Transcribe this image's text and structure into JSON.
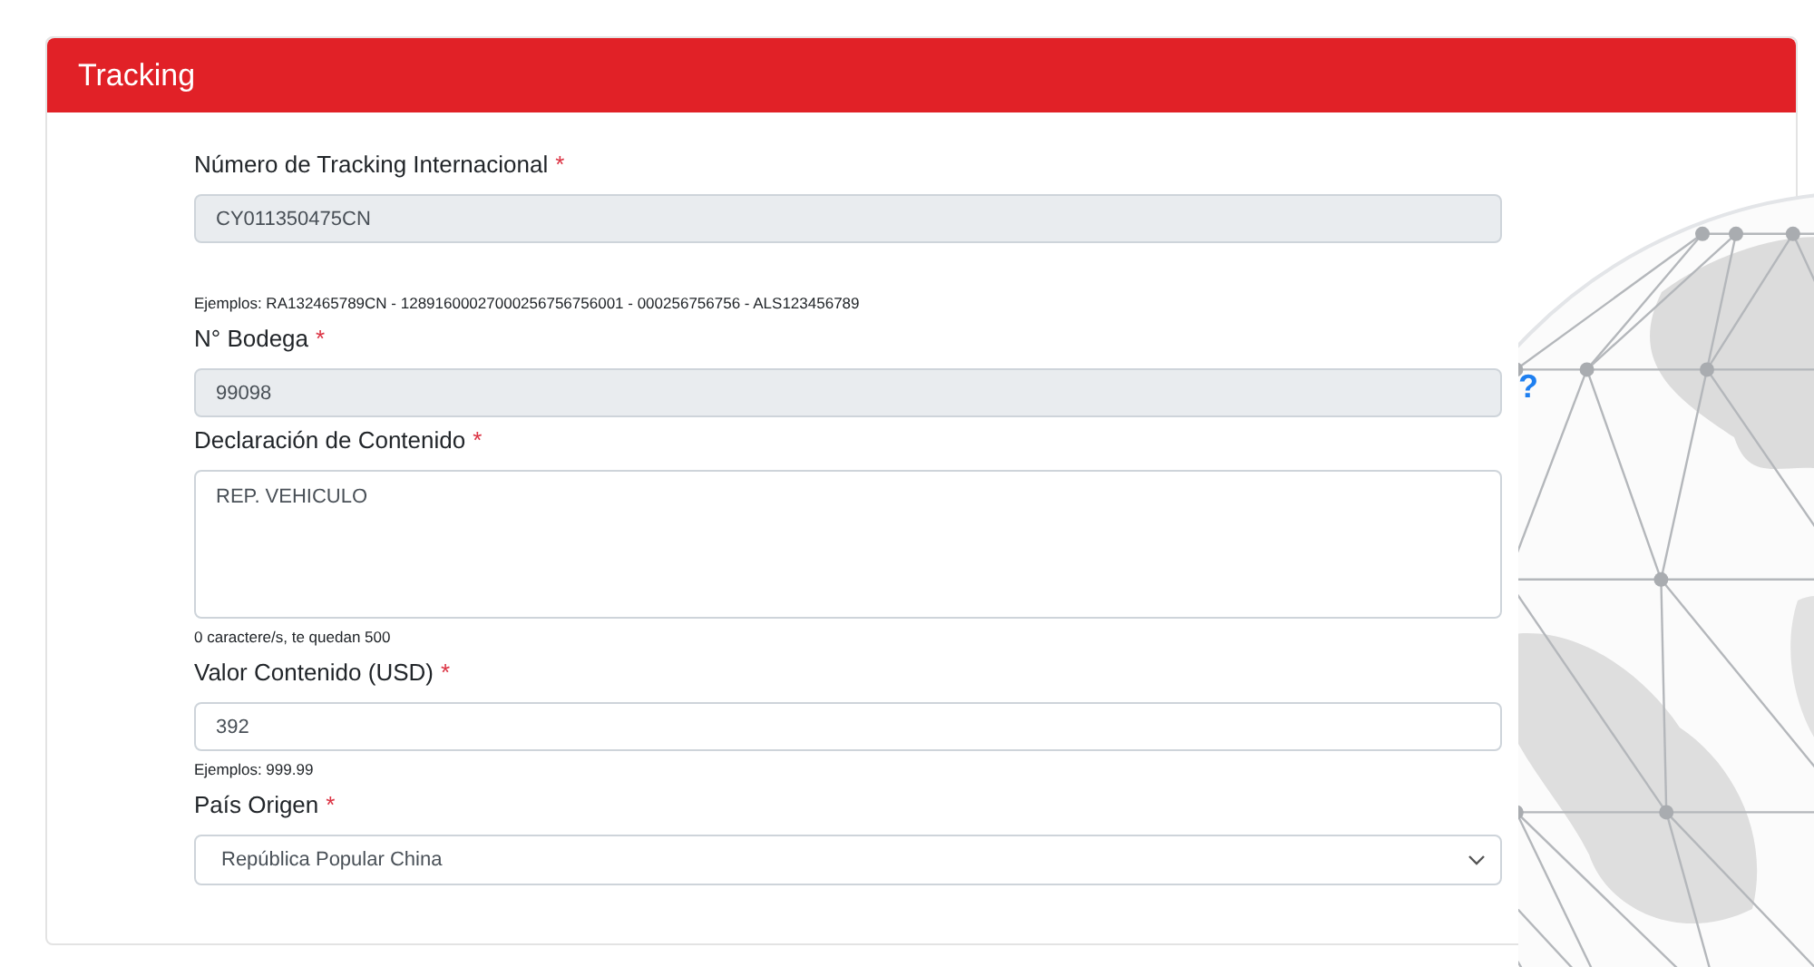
{
  "card": {
    "title": "Tracking"
  },
  "fields": [
    {
      "kind": "input",
      "label": "Número de Tracking Internacional",
      "required_mark": "*",
      "value": "CY011350475CN",
      "disabled": true,
      "hint": "Ejemplos: RA132465789CN - 12891600027000256756756001 - 000256756756 - ALS123456789"
    },
    {
      "kind": "input",
      "label": "N° Bodega",
      "required_mark": "*",
      "value": "99098",
      "disabled": true,
      "help": "?"
    },
    {
      "kind": "textarea",
      "label": "Declaración de Contenido",
      "required_mark": "*",
      "value": "REP. VEHICULO",
      "disabled": false,
      "hint": "0 caractere/s, te quedan 500"
    },
    {
      "kind": "input",
      "label": "Valor Contenido (USD)",
      "required_mark": "*",
      "value": "392",
      "disabled": false,
      "hint": "Ejemplos: 999.99"
    },
    {
      "kind": "select",
      "label": "País Origen",
      "required_mark": "*",
      "value": "República Popular China",
      "disabled": false
    }
  ]
}
